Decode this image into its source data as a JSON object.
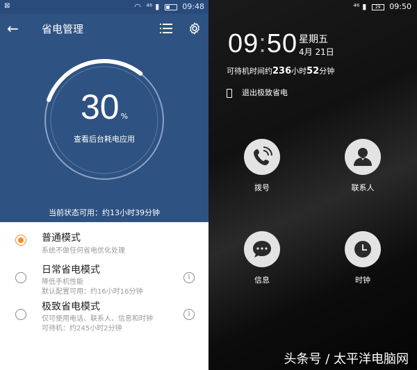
{
  "left": {
    "status_bar": {
      "left_text": "⊠",
      "network": "⁴⁶",
      "battery": "",
      "time": "09:48"
    },
    "header": {
      "title": "省电管理",
      "back_icon": "arrow-left-icon",
      "list_icon": "list-icon",
      "settings_icon": "gear-icon"
    },
    "battery": {
      "percent": "30",
      "unit": "%",
      "level": 0.3,
      "subtitle": "查看后台耗电应用",
      "available": "当前状态可用：约13小时39分钟"
    },
    "modes": [
      {
        "title": "普通模式",
        "desc1": "系统不做任何省电优化处理",
        "desc2": "",
        "selected": true
      },
      {
        "title": "日常省电模式",
        "desc1": "降低手机性能",
        "desc2": "默认配置可用：约16小时16分钟",
        "selected": false
      },
      {
        "title": "极致省电模式",
        "desc1": "仅可使用电话、联系人、信息和时钟",
        "desc2": "可待机：约245小时2分钟",
        "selected": false
      }
    ],
    "colors": {
      "header_bg": "#2e5282",
      "accent": "#f58c1f"
    }
  },
  "right": {
    "status_bar": {
      "network": "⁴⁶",
      "battery": "29",
      "time": "09:50"
    },
    "clock": {
      "hour": "09",
      "colon": ":",
      "minute": "50"
    },
    "weekday": "星期五",
    "date": "4月 21日",
    "standby": {
      "prefix": "可待机时间约",
      "hours": "236",
      "hours_unit": "小时",
      "minutes": "52",
      "minutes_unit": "分钟"
    },
    "exit_label": "退出极致省电",
    "apps": [
      {
        "label": "拨号",
        "icon": "phone-icon"
      },
      {
        "label": "联系人",
        "icon": "contact-icon"
      },
      {
        "label": "信息",
        "icon": "message-icon"
      },
      {
        "label": "时钟",
        "icon": "clock-icon"
      }
    ],
    "watermark": "头条号 / 太平洋电脑网"
  }
}
